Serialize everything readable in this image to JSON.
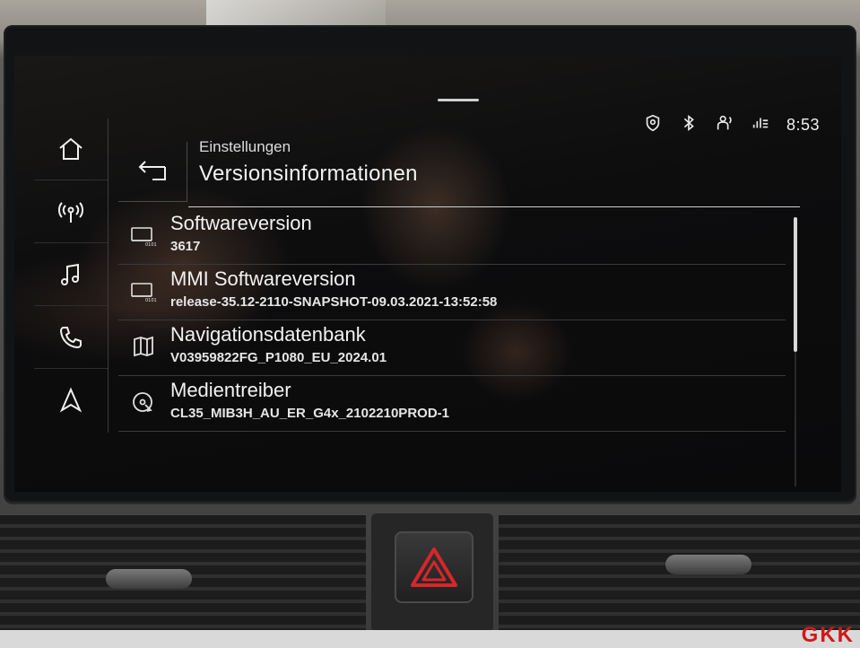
{
  "status_bar": {
    "time": "8:53",
    "icons": [
      "location-shield-icon",
      "bluetooth-icon",
      "person-voice-icon",
      "signal-settings-icon"
    ]
  },
  "nav": {
    "items": [
      {
        "name": "home-icon",
        "active": false
      },
      {
        "name": "radio-icon",
        "active": false
      },
      {
        "name": "music-icon",
        "active": false
      },
      {
        "name": "phone-icon",
        "active": false
      },
      {
        "name": "navigation-icon",
        "active": false
      }
    ]
  },
  "header": {
    "breadcrumb": "Einstellungen",
    "title": "Versionsinformationen"
  },
  "list": {
    "items": [
      {
        "title": "Softwareversion",
        "value": "3617",
        "icon": "memory-card-icon"
      },
      {
        "title": "MMI Softwareversion",
        "value": "release-35.12-2110-SNAPSHOT-09.03.2021-13:52:58",
        "icon": "memory-card-icon"
      },
      {
        "title": "Navigationsdatenbank",
        "value": "V03959822FG_P1080_EU_2024.01",
        "icon": "map-icon"
      },
      {
        "title": "Medientreiber",
        "value": "CL35_MIB3H_AU_ER_G4x_2102210PROD-1",
        "icon": "media-disc-icon"
      }
    ]
  },
  "watermark": "GKK",
  "colors": {
    "screen_bg": "#0d0d0e",
    "text": "#f2f2f2",
    "hazard_red": "#d8262a",
    "watermark": "#d01818"
  }
}
